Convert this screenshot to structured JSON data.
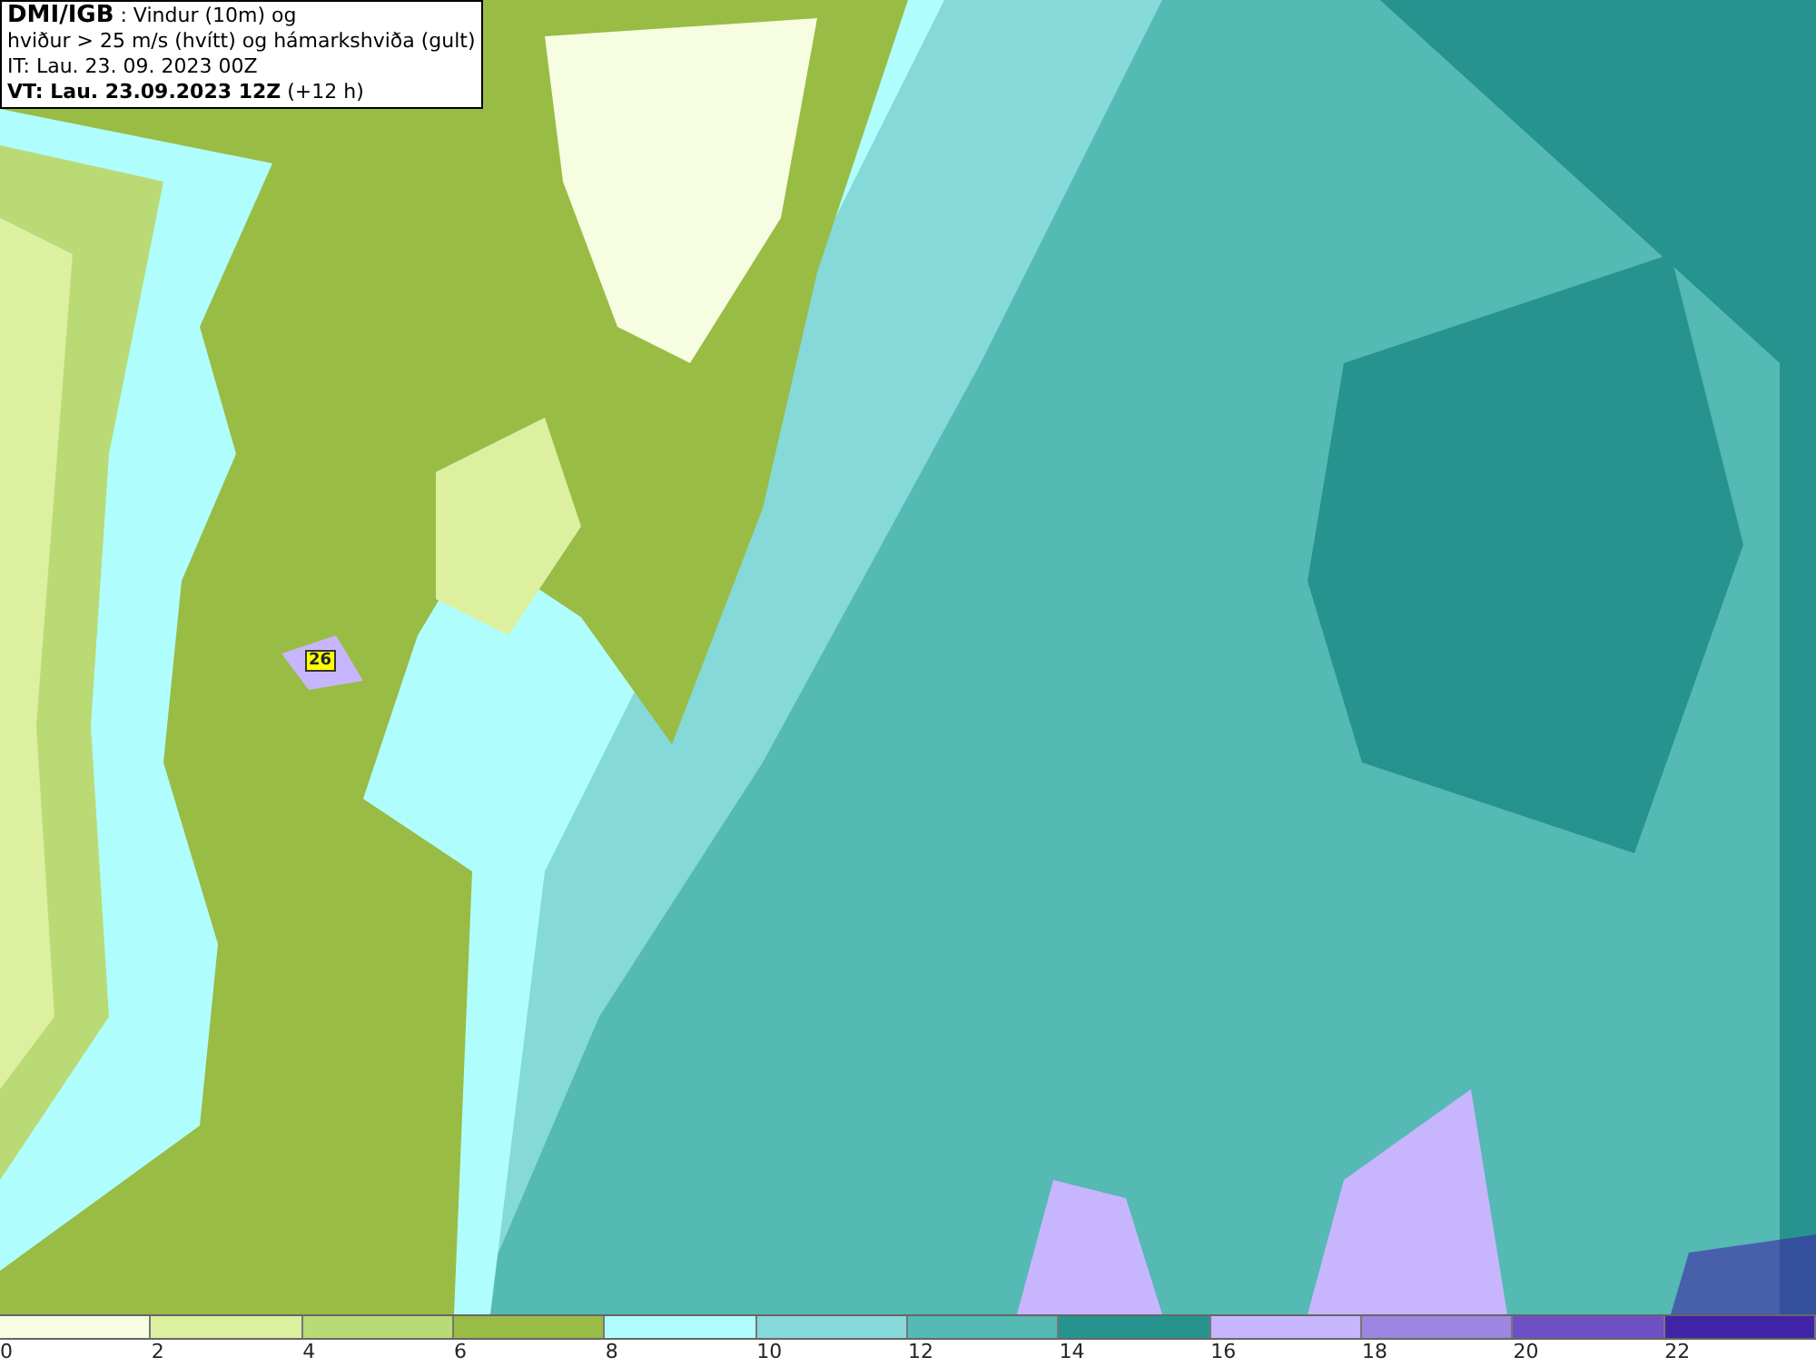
{
  "title_box": {
    "source": "DMI/IGB",
    "line_1": " : Vindur (10m) og",
    "line_2": "hviður > 25 m/s (hvítt) og hámarkshviða (gult)",
    "line_3": "IT: Lau. 23. 09. 2023 00Z",
    "line_4_bold": "VT: Lau. 23.09.2023 12Z",
    "line_4_rest": " (+12 h)"
  },
  "map": {
    "gust_labels": [
      {
        "text": "26"
      }
    ]
  },
  "legend": [
    {
      "label": "0",
      "color": "#f7fde0"
    },
    {
      "label": "2",
      "color": "#dcf0a0"
    },
    {
      "label": "4",
      "color": "#b9da75"
    },
    {
      "label": "6",
      "color": "#99bc45"
    },
    {
      "label": "8",
      "color": "#b0fdfd"
    },
    {
      "label": "10",
      "color": "#85d9d9"
    },
    {
      "label": "12",
      "color": "#55b9b4"
    },
    {
      "label": "14",
      "color": "#27938e"
    },
    {
      "label": "16",
      "color": "#c7b6fd"
    },
    {
      "label": "18",
      "color": "#9c86e0"
    },
    {
      "label": "20",
      "color": "#6f50c4"
    },
    {
      "label": "22",
      "color": "#4024a6"
    }
  ]
}
